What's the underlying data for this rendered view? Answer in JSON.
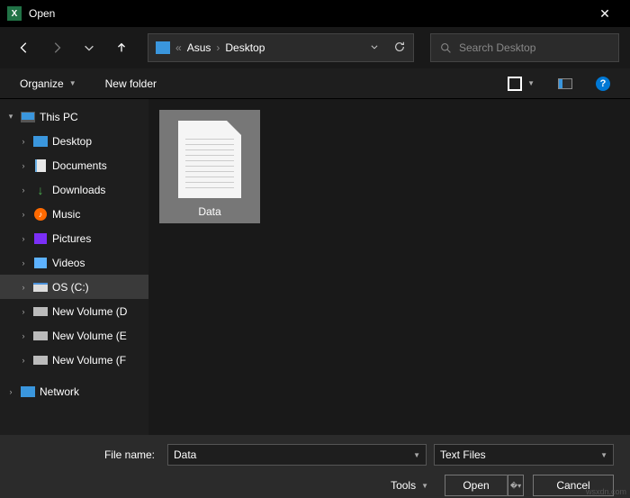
{
  "titlebar": {
    "title": "Open",
    "close": "✕"
  },
  "nav": {},
  "breadcrumb": {
    "pre": "«",
    "parts": [
      "Asus",
      "Desktop"
    ]
  },
  "search": {
    "placeholder": "Search Desktop"
  },
  "toolbar": {
    "organize": "Organize",
    "newfolder": "New folder"
  },
  "sidebar": {
    "thispc": "This PC",
    "items": [
      {
        "label": "Desktop"
      },
      {
        "label": "Documents"
      },
      {
        "label": "Downloads"
      },
      {
        "label": "Music"
      },
      {
        "label": "Pictures"
      },
      {
        "label": "Videos"
      },
      {
        "label": "OS (C:)"
      },
      {
        "label": "New Volume (D"
      },
      {
        "label": "New Volume (E"
      },
      {
        "label": "New Volume (F"
      }
    ],
    "network": "Network"
  },
  "files": {
    "item0": {
      "label": "Data"
    }
  },
  "bottom": {
    "filename_label": "File name:",
    "filename_value": "Data",
    "filetype_value": "Text Files",
    "tools": "Tools",
    "open": "Open",
    "cancel": "Cancel"
  },
  "watermark": "wsxdn.com"
}
